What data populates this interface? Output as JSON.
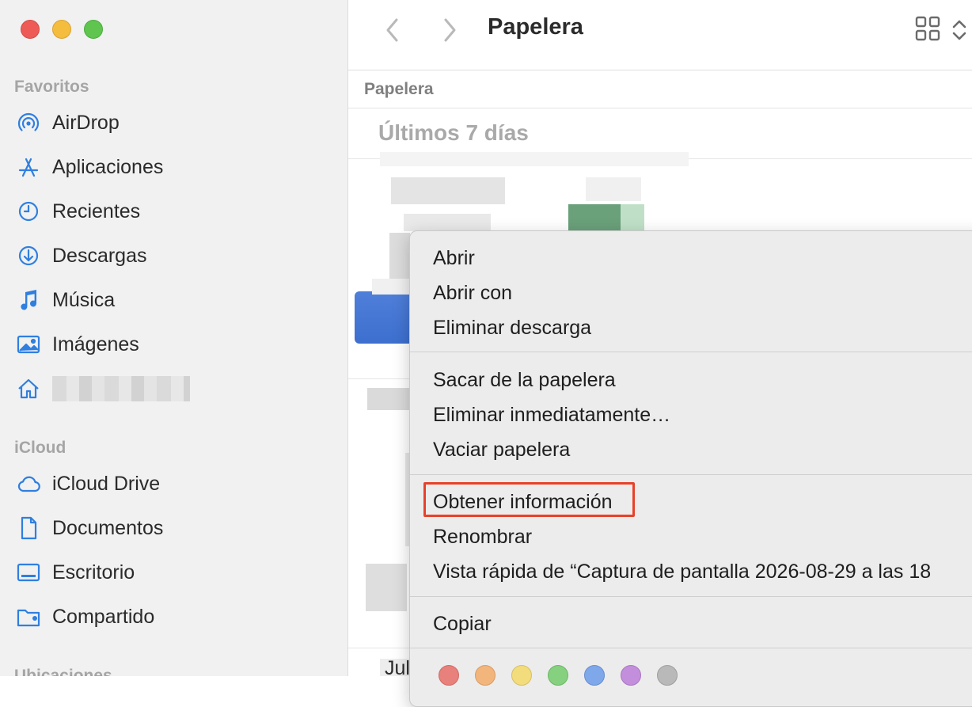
{
  "window": {
    "title": "Papelera"
  },
  "sidebar": {
    "sections": [
      {
        "title": "Favoritos"
      },
      {
        "title": "iCloud"
      },
      {
        "title": "Ubicaciones"
      }
    ],
    "favorites": [
      {
        "label": "AirDrop",
        "icon": "airdrop-icon"
      },
      {
        "label": "Aplicaciones",
        "icon": "applications-icon"
      },
      {
        "label": "Recientes",
        "icon": "clock-icon"
      },
      {
        "label": "Descargas",
        "icon": "download-icon"
      },
      {
        "label": "Música",
        "icon": "music-note-icon"
      },
      {
        "label": "Imágenes",
        "icon": "photo-icon"
      },
      {
        "label": "",
        "icon": "home-icon"
      }
    ],
    "icloud": [
      {
        "label": "iCloud Drive",
        "icon": "cloud-icon"
      },
      {
        "label": "Documentos",
        "icon": "document-icon"
      },
      {
        "label": "Escritorio",
        "icon": "desktop-icon"
      },
      {
        "label": "Compartido",
        "icon": "shared-folder-icon"
      }
    ]
  },
  "main": {
    "path": "Papelera",
    "group_header": "Últimos 7 días",
    "partial_text": "Jul"
  },
  "context_menu": {
    "group1": [
      "Abrir",
      "Abrir con",
      "Eliminar descarga"
    ],
    "group2": [
      "Sacar de la papelera",
      "Eliminar inmediatamente…",
      "Vaciar papelera"
    ],
    "group3": [
      "Obtener información",
      "Renombrar",
      "Vista rápida de “Captura de pantalla 2026-08-29 a las 18"
    ],
    "group4": [
      "Copiar"
    ],
    "highlighted_item": "Obtener información",
    "tag_colors": [
      "#e8807c",
      "#f2b57b",
      "#f2dc7c",
      "#86d17f",
      "#7fa8ea",
      "#c38fdc",
      "#b9b9b9"
    ]
  },
  "colors": {
    "accent": "#2f7fe0",
    "highlight_box": "#e8412a"
  }
}
